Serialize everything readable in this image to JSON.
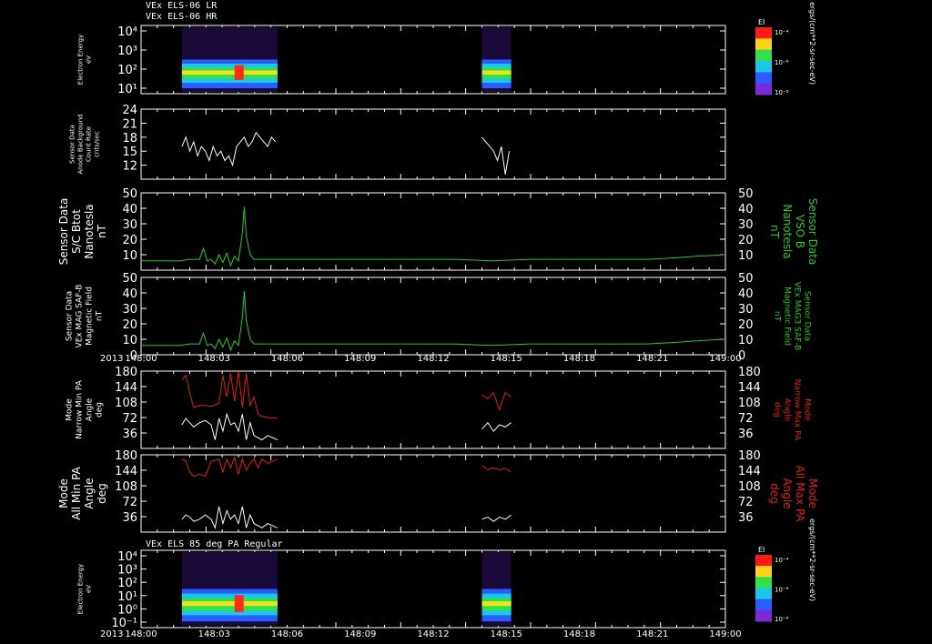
{
  "header": {
    "line1": "VEx ELS-06 LR",
    "line2": "VEx ELS-06 HR",
    "middle": "VEx ELS 85 deg PA Regular"
  },
  "colors": {
    "white": "#ffffff",
    "green": "#22cc22",
    "red": "#dd2211",
    "frame": "#ffffff"
  },
  "time_axis": {
    "year": "2013",
    "ticks": [
      "148:00",
      "148:03",
      "148:06",
      "148:09",
      "148:12",
      "148:15",
      "148:18",
      "148:21",
      "149:00"
    ]
  },
  "colorbar": {
    "title": "EI",
    "labels": [
      "10⁻⁴",
      "10⁻⁶",
      "10⁻⁸"
    ],
    "units": "ergs/(cm**2-sr-sec-eV)"
  },
  "chart_data": [
    {
      "id": "spec1",
      "type": "heatmap",
      "ylabel": [
        "Electron Energy",
        "eV"
      ],
      "yticks": [
        "10⁴",
        "10³",
        "10²",
        "10¹"
      ],
      "data_intervals_hours": [
        [
          0.21,
          0.7
        ],
        [
          1.75,
          1.9
        ]
      ]
    },
    {
      "id": "bkg",
      "type": "line",
      "ylabel": [
        "Sensor Data",
        "Anode Background",
        "Count Rate",
        "cnts/sec"
      ],
      "ylim": [
        9,
        24
      ],
      "yticks": [
        24,
        21,
        18,
        15,
        12
      ],
      "x_hours": [
        0.21,
        0.23,
        0.25,
        0.27,
        0.29,
        0.31,
        0.33,
        0.35,
        0.37,
        0.39,
        0.41,
        0.43,
        0.45,
        0.47,
        0.49,
        0.51,
        0.53,
        0.55,
        0.57,
        0.59,
        0.61,
        0.63,
        0.65,
        0.67,
        0.69,
        1.75,
        1.77,
        1.79,
        1.81,
        1.83,
        1.85,
        1.87,
        1.89
      ],
      "values": [
        16,
        18,
        15,
        17,
        14,
        16,
        15,
        13,
        16,
        14,
        15,
        13,
        14,
        12,
        16,
        17,
        18,
        16,
        17,
        19,
        18,
        17,
        16,
        18,
        17,
        18,
        17,
        16,
        15,
        13,
        16,
        10,
        15
      ]
    },
    {
      "id": "bmag1",
      "type": "line",
      "ylabel": [
        "Sensor Data",
        "S/C Btot",
        "Nanotesla",
        "nT"
      ],
      "ylabel_right": [
        "Sensor Data",
        "VSO B",
        "Nanotesla",
        "nT"
      ],
      "ylim": [
        0,
        50
      ],
      "yticks": [
        50,
        40,
        30,
        20,
        10
      ],
      "x_hours": [
        0,
        0.2,
        0.25,
        0.3,
        0.32,
        0.34,
        0.36,
        0.38,
        0.4,
        0.42,
        0.44,
        0.46,
        0.48,
        0.5,
        0.52,
        0.53,
        0.54,
        0.56,
        0.58,
        0.62,
        0.8,
        1.0,
        1.3,
        1.6,
        1.8,
        2.0,
        2.3,
        2.6,
        2.75,
        2.85,
        3.0
      ],
      "values": [
        6,
        6,
        7,
        7,
        14,
        6,
        7,
        4,
        10,
        5,
        11,
        3,
        9,
        6,
        24,
        41,
        22,
        10,
        7,
        7,
        7,
        7,
        7,
        7,
        6,
        7,
        7,
        7,
        8,
        9,
        10
      ]
    },
    {
      "id": "bmag2",
      "type": "line",
      "ylabel": [
        "Sensor Data",
        "VEx MAG SAF-B",
        "Magnetic Field",
        "nT"
      ],
      "ylabel_right": [
        "Sensor Data",
        "VEx MAG3 SAF-B",
        "Magnetic Field",
        "nT"
      ],
      "ylim": [
        0,
        50
      ],
      "yticks": [
        50,
        40,
        30,
        20,
        10,
        0
      ],
      "x_hours": [
        0,
        0.2,
        0.25,
        0.3,
        0.32,
        0.34,
        0.36,
        0.38,
        0.4,
        0.42,
        0.44,
        0.46,
        0.48,
        0.5,
        0.52,
        0.53,
        0.54,
        0.56,
        0.58,
        0.62,
        0.8,
        1.0,
        1.3,
        1.6,
        1.8,
        2.0,
        2.3,
        2.6,
        2.75,
        2.85,
        3.0
      ],
      "values": [
        6,
        6,
        7,
        7,
        14,
        6,
        7,
        4,
        10,
        5,
        11,
        3,
        9,
        6,
        24,
        41,
        22,
        10,
        7,
        7,
        7,
        7,
        7,
        7,
        6,
        7,
        7,
        7,
        8,
        9,
        10
      ]
    },
    {
      "id": "pa_narrow",
      "type": "line",
      "ylabel": [
        "Mode",
        "Narrow Min PA",
        "Angle",
        "deg"
      ],
      "ylabel_right": [
        "Mode",
        "Narrow Max PA",
        "Angle",
        "deg"
      ],
      "ylim": [
        0,
        180
      ],
      "yticks": [
        180,
        144,
        108,
        72,
        36
      ],
      "series": [
        {
          "color": "red",
          "x_hours": [
            0.21,
            0.23,
            0.25,
            0.27,
            0.3,
            0.33,
            0.36,
            0.4,
            0.42,
            0.44,
            0.46,
            0.48,
            0.5,
            0.52,
            0.54,
            0.56,
            0.58,
            0.6,
            0.62,
            0.65,
            0.7,
            1.75,
            1.78,
            1.81,
            1.84,
            1.87,
            1.9
          ],
          "values": [
            160,
            170,
            130,
            95,
            100,
            100,
            98,
            105,
            170,
            120,
            175,
            110,
            180,
            95,
            175,
            100,
            120,
            80,
            75,
            72,
            70,
            125,
            115,
            130,
            90,
            130,
            120
          ]
        },
        {
          "color": "white",
          "x_hours": [
            0.21,
            0.23,
            0.25,
            0.27,
            0.3,
            0.33,
            0.36,
            0.38,
            0.4,
            0.42,
            0.44,
            0.46,
            0.48,
            0.5,
            0.52,
            0.54,
            0.56,
            0.58,
            0.6,
            0.62,
            0.65,
            0.7,
            1.75,
            1.78,
            1.81,
            1.84,
            1.87,
            1.9
          ],
          "values": [
            55,
            70,
            60,
            50,
            60,
            65,
            55,
            20,
            70,
            40,
            80,
            55,
            60,
            40,
            80,
            20,
            60,
            30,
            25,
            20,
            30,
            20,
            45,
            60,
            40,
            55,
            50,
            60
          ]
        }
      ]
    },
    {
      "id": "pa_all",
      "type": "line",
      "ylabel": [
        "Mode",
        "All Min PA",
        "Angle",
        "deg"
      ],
      "ylabel_right": [
        "Mode",
        "All Max PA",
        "Angle",
        "deg"
      ],
      "ylim": [
        0,
        180
      ],
      "yticks": [
        180,
        144,
        108,
        72,
        36
      ],
      "series": [
        {
          "color": "red",
          "x_hours": [
            0.21,
            0.23,
            0.25,
            0.27,
            0.3,
            0.33,
            0.36,
            0.4,
            0.42,
            0.44,
            0.46,
            0.48,
            0.5,
            0.52,
            0.54,
            0.56,
            0.58,
            0.6,
            0.62,
            0.65,
            0.7,
            1.75,
            1.78,
            1.81,
            1.84,
            1.87,
            1.9
          ],
          "values": [
            170,
            165,
            140,
            130,
            135,
            130,
            165,
            170,
            140,
            170,
            150,
            175,
            135,
            170,
            145,
            160,
            170,
            150,
            170,
            160,
            170,
            155,
            145,
            150,
            145,
            148,
            140
          ]
        },
        {
          "color": "white",
          "x_hours": [
            0.21,
            0.23,
            0.25,
            0.27,
            0.3,
            0.33,
            0.36,
            0.38,
            0.4,
            0.42,
            0.44,
            0.46,
            0.48,
            0.5,
            0.52,
            0.54,
            0.56,
            0.58,
            0.6,
            0.62,
            0.65,
            0.7,
            1.75,
            1.78,
            1.81,
            1.84,
            1.87,
            1.9
          ],
          "values": [
            30,
            40,
            35,
            25,
            30,
            40,
            30,
            10,
            60,
            20,
            50,
            30,
            40,
            20,
            60,
            10,
            40,
            20,
            15,
            10,
            20,
            10,
            30,
            35,
            25,
            35,
            30,
            40
          ]
        }
      ]
    },
    {
      "id": "spec2",
      "type": "heatmap",
      "ylabel": [
        "Electron Energy",
        "eV"
      ],
      "yticks": [
        "10⁴",
        "10³",
        "10²",
        "10¹",
        "10⁰",
        "10⁻¹"
      ],
      "data_intervals_hours": [
        [
          0.21,
          0.7
        ],
        [
          1.75,
          1.9
        ]
      ]
    }
  ]
}
